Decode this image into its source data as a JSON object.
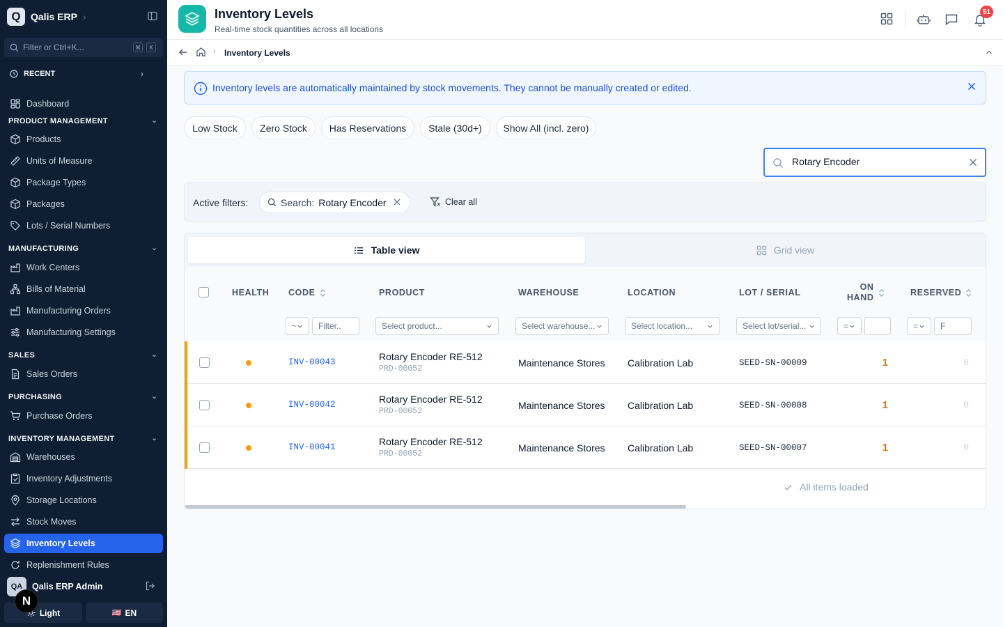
{
  "app": {
    "logo_letter": "Q",
    "name": "Qalis ERP"
  },
  "sidebar": {
    "search_placeholder": "Filter or Ctrl+K...",
    "kbd1": "⌘",
    "kbd2": "K",
    "recent": "RECENT",
    "dashboard": "Dashboard",
    "sections": {
      "product": {
        "title": "PRODUCT MANAGEMENT",
        "items": [
          "Products",
          "Units of Measure",
          "Package Types",
          "Packages",
          "Lots / Serial Numbers"
        ]
      },
      "manufacturing": {
        "title": "MANUFACTURING",
        "items": [
          "Work Centers",
          "Bills of Material",
          "Manufacturing Orders",
          "Manufacturing Settings"
        ]
      },
      "sales": {
        "title": "SALES",
        "items": [
          "Sales Orders"
        ]
      },
      "purchasing": {
        "title": "PURCHASING",
        "items": [
          "Purchase Orders"
        ]
      },
      "inventory": {
        "title": "INVENTORY MANAGEMENT",
        "items": [
          "Warehouses",
          "Inventory Adjustments",
          "Storage Locations",
          "Stock Moves",
          "Inventory Levels",
          "Replenishment Rules"
        ]
      }
    },
    "user": {
      "initials": "QA",
      "name": "Qalis ERP Admin"
    },
    "theme_label": "Light",
    "lang_flag": "🇺🇸",
    "lang_label": "EN",
    "next_badge": "N"
  },
  "header": {
    "title": "Inventory Levels",
    "subtitle": "Real-time stock quantities across all locations",
    "notif_count": "51"
  },
  "breadcrumb": {
    "current": "Inventory Levels"
  },
  "banner": {
    "text": "Inventory levels are automatically maintained by stock movements. They cannot be manually created or edited."
  },
  "quick_filters": [
    "Low Stock",
    "Zero Stock",
    "Has Reservations",
    "Stale (30d+)",
    "Show All (incl. zero)"
  ],
  "search": {
    "value": "Rotary Encoder"
  },
  "active_filters": {
    "label": "Active filters:",
    "chip_label": "Search:",
    "chip_value": "Rotary Encoder",
    "clear_all": "Clear all"
  },
  "views": {
    "table": "Table view",
    "grid": "Grid view"
  },
  "columns": {
    "health": "HEALTH",
    "code": "CODE",
    "product": "PRODUCT",
    "warehouse": "WAREHOUSE",
    "location": "LOCATION",
    "lot": "LOT / SERIAL",
    "on_hand_1": "ON",
    "on_hand_2": "HAND",
    "reserved": "RESERVED"
  },
  "column_filters": {
    "code_op": "~",
    "code_placeholder": "Filter..",
    "product": "Select product...",
    "warehouse": "Select warehouse...",
    "location": "Select location...",
    "lot": "Select lot/serial...",
    "onhand_op": "=",
    "reserved_op": "=",
    "reserved_value": "F"
  },
  "rows": [
    {
      "code": "INV-00043",
      "product": "Rotary Encoder RE-512",
      "product_code": "PRD-00052",
      "warehouse": "Maintenance Stores",
      "location": "Calibration Lab",
      "lot": "SEED-SN-00009",
      "on_hand": "1",
      "reserved": "0"
    },
    {
      "code": "INV-00042",
      "product": "Rotary Encoder RE-512",
      "product_code": "PRD-00052",
      "warehouse": "Maintenance Stores",
      "location": "Calibration Lab",
      "lot": "SEED-SN-00008",
      "on_hand": "1",
      "reserved": "0"
    },
    {
      "code": "INV-00041",
      "product": "Rotary Encoder RE-512",
      "product_code": "PRD-00052",
      "warehouse": "Maintenance Stores",
      "location": "Calibration Lab",
      "lot": "SEED-SN-00007",
      "on_hand": "1",
      "reserved": "0"
    }
  ],
  "footer": {
    "loaded": "All items loaded"
  },
  "colors": {
    "sidebar_bg": "#0f1e33",
    "active_item": "#2563eb",
    "accent_teal": "#14b8a6",
    "warning": "#f59e0b",
    "link": "#2563eb"
  }
}
